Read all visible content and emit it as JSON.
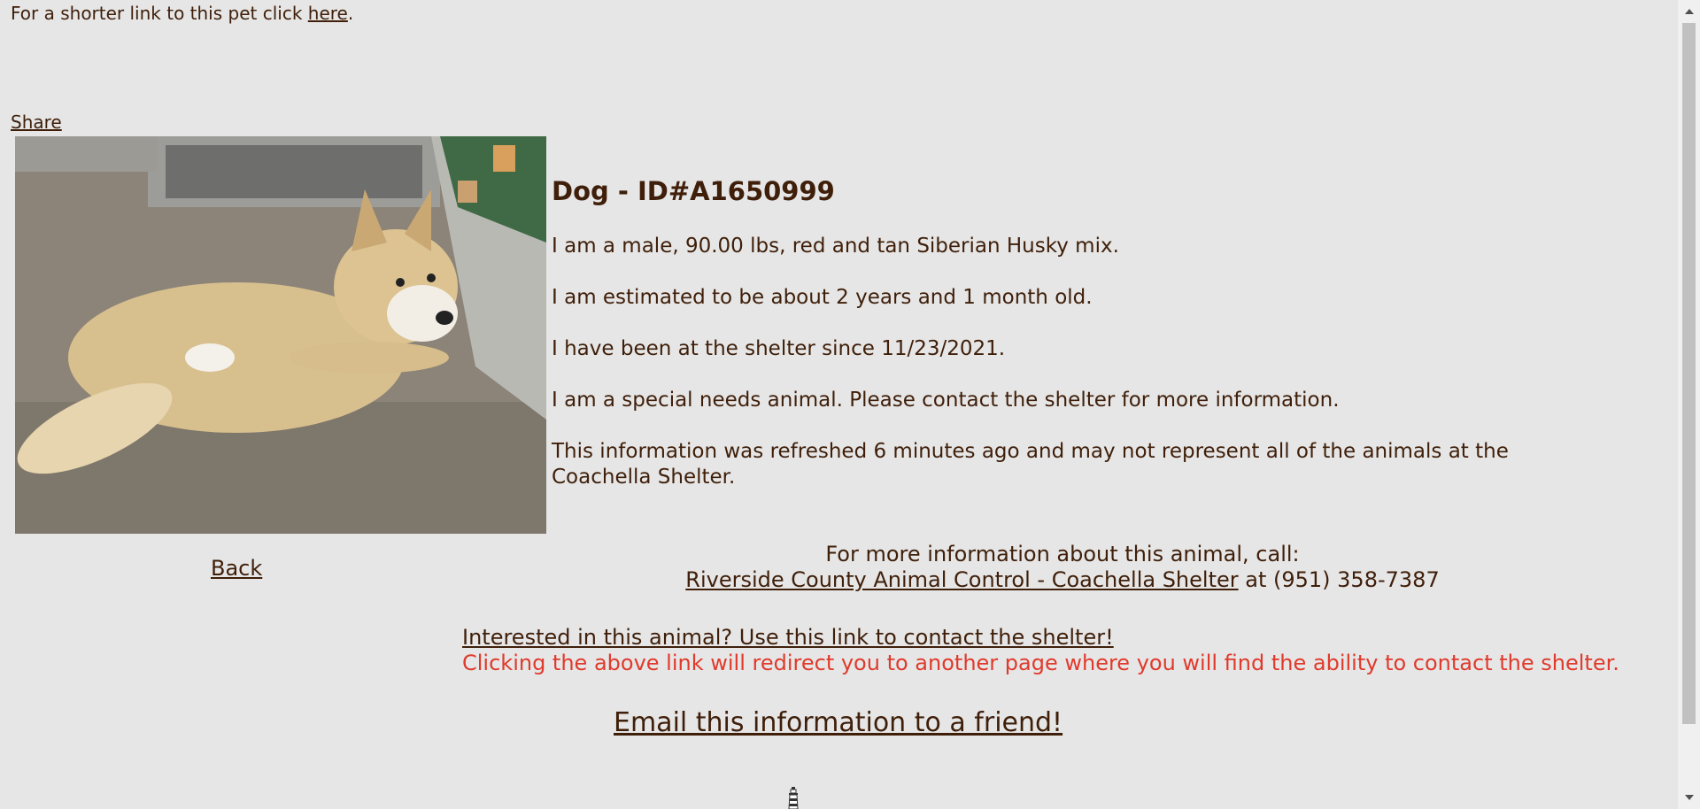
{
  "header": {
    "short_link_prefix": "For a shorter link to this pet click ",
    "short_link_text": "here",
    "short_link_suffix": ".",
    "share_label": "Share"
  },
  "animal": {
    "title": "Dog - ID#A1650999",
    "description": "I am a male, 90.00 lbs, red and tan Siberian Husky mix.",
    "age": "I am estimated to be about 2 years and 1 month old.",
    "intake": "I have been at the shelter since 11/23/2021.",
    "special_needs": "I am a special needs animal. Please contact the shelter for more information.",
    "refresh_note": "This information was refreshed 6 minutes ago and may not represent all of the animals at the Coachella Shelter."
  },
  "back_label": "Back",
  "contact": {
    "call_prompt": "For more information about this animal, call:",
    "shelter_link": "Riverside County Animal Control - Coachella Shelter",
    "phone_text": " at (951) 358-7387"
  },
  "interest": {
    "link_text": "Interested in this animal? Use this link to contact the shelter!",
    "warning_text": "Clicking the above link will redirect you to another page where you will find the ability to contact the shelter."
  },
  "email_label": "Email this information to a friend!",
  "colors": {
    "background": "#e6e6e6",
    "text": "#3f1f0a",
    "warning": "#e03a2c"
  },
  "icons": {
    "bottom": "lighthouse-icon",
    "scroll_up": "scroll-up-arrow-icon",
    "scroll_down": "scroll-down-arrow-icon"
  }
}
